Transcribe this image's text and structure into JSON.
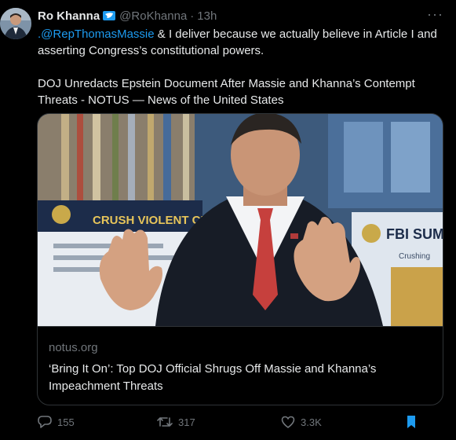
{
  "author": {
    "name": "Ro Khanna",
    "handle": "@RoKhanna",
    "separator": "·",
    "time": "13h",
    "more": "···"
  },
  "tweet": {
    "mention": ".@RepThomasMassie",
    "line1_rest": " & I deliver because we actually believe in Article I and asserting Congress’s constitutional powers.",
    "para2": "DOJ Unredacts Epstein Document After Massie and Khanna’s Contempt Threats - NOTUS — News of the United States"
  },
  "card": {
    "image_text": {
      "crush": "CRUSH VIOLENT CR",
      "fbi": "FBI SUM",
      "crushing": "Crushing"
    },
    "domain": "notus.org",
    "title": "‘Bring It On’: Top DOJ Official Shrugs Off Massie and Khanna’s Impeachment Threats"
  },
  "actions": {
    "replies": "155",
    "retweets": "317",
    "likes": "3.3K"
  },
  "colors": {
    "background": "#000000",
    "text": "#e7e9ea",
    "muted": "#71767b",
    "accent": "#1d9bf0",
    "border": "#2f3336"
  },
  "icons": {
    "verified": "verified-badge-icon",
    "more": "more-dots-icon",
    "reply": "reply-icon",
    "retweet": "retweet-icon",
    "like": "heart-icon",
    "bookmark": "bookmark-icon"
  }
}
